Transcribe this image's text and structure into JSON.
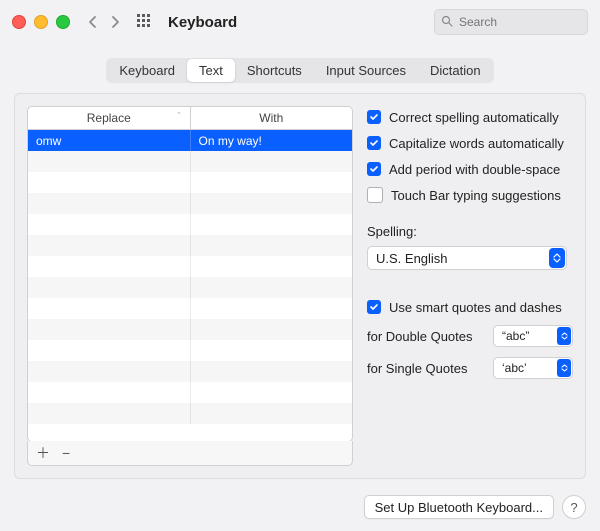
{
  "window": {
    "title": "Keyboard"
  },
  "search": {
    "placeholder": "Search"
  },
  "tabs": {
    "items": [
      {
        "label": "Keyboard"
      },
      {
        "label": "Text"
      },
      {
        "label": "Shortcuts"
      },
      {
        "label": "Input Sources"
      },
      {
        "label": "Dictation"
      }
    ],
    "active_index": 1
  },
  "table": {
    "headers": {
      "replace": "Replace",
      "with": "With"
    },
    "rows": [
      {
        "replace": "omw",
        "with": "On my way!",
        "selected": true
      }
    ]
  },
  "options": {
    "correct_spelling": {
      "label": "Correct spelling automatically",
      "checked": true
    },
    "capitalize": {
      "label": "Capitalize words automatically",
      "checked": true
    },
    "double_space": {
      "label": "Add period with double-space",
      "checked": true
    },
    "touch_bar": {
      "label": "Touch Bar typing suggestions",
      "checked": false
    },
    "spelling_label": "Spelling:",
    "spelling_value": "U.S. English",
    "smart_quotes": {
      "label": "Use smart quotes and dashes",
      "checked": true
    },
    "double_quotes_label": "for Double Quotes",
    "double_quotes_value": "“abc”",
    "single_quotes_label": "for Single Quotes",
    "single_quotes_value": "‘abc’"
  },
  "footer": {
    "bluetooth_button": "Set Up Bluetooth Keyboard...",
    "help_button": "?"
  }
}
